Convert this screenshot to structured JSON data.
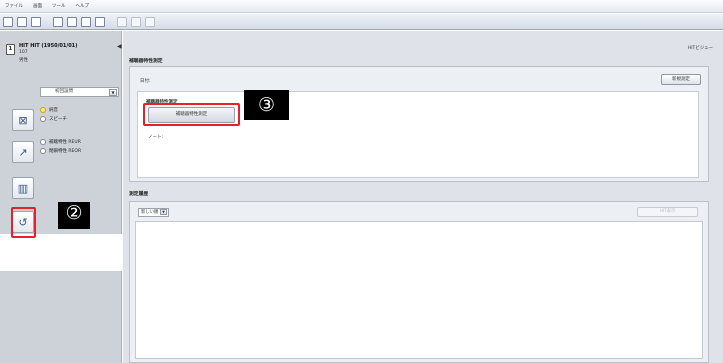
{
  "menu": [
    "ファイル",
    "画面",
    "ツール",
    "ヘルプ"
  ],
  "patient": {
    "name": "HIT HIT (1950/01/01)",
    "id": "107",
    "sex": "男性",
    "icon_label": "1"
  },
  "sidebar": {
    "select_value": "初回設問",
    "radio_group_1": [
      "純音",
      "スピーチ"
    ],
    "radio_group_2": [
      "補聴特性 REUR",
      "閉鎖特性 REOR"
    ]
  },
  "badges": {
    "b2": "②",
    "b3": "③"
  },
  "main": {
    "breadcrumb": "HITビジュー",
    "section1_title": "補聴器特性測定",
    "date_label": "日付:",
    "new_button": "新規測定",
    "inner_title": "補聴器特性測定",
    "measure_button": "補聴器特性測定",
    "note_label": "ノート:",
    "section2_title": "測定履歴",
    "sort_value": "新しい順",
    "hit_button": "HIT表示"
  },
  "colors": {
    "highlight": "#e8202a",
    "sidebar": "#cdd1d8",
    "main": "#dfe3e9"
  }
}
